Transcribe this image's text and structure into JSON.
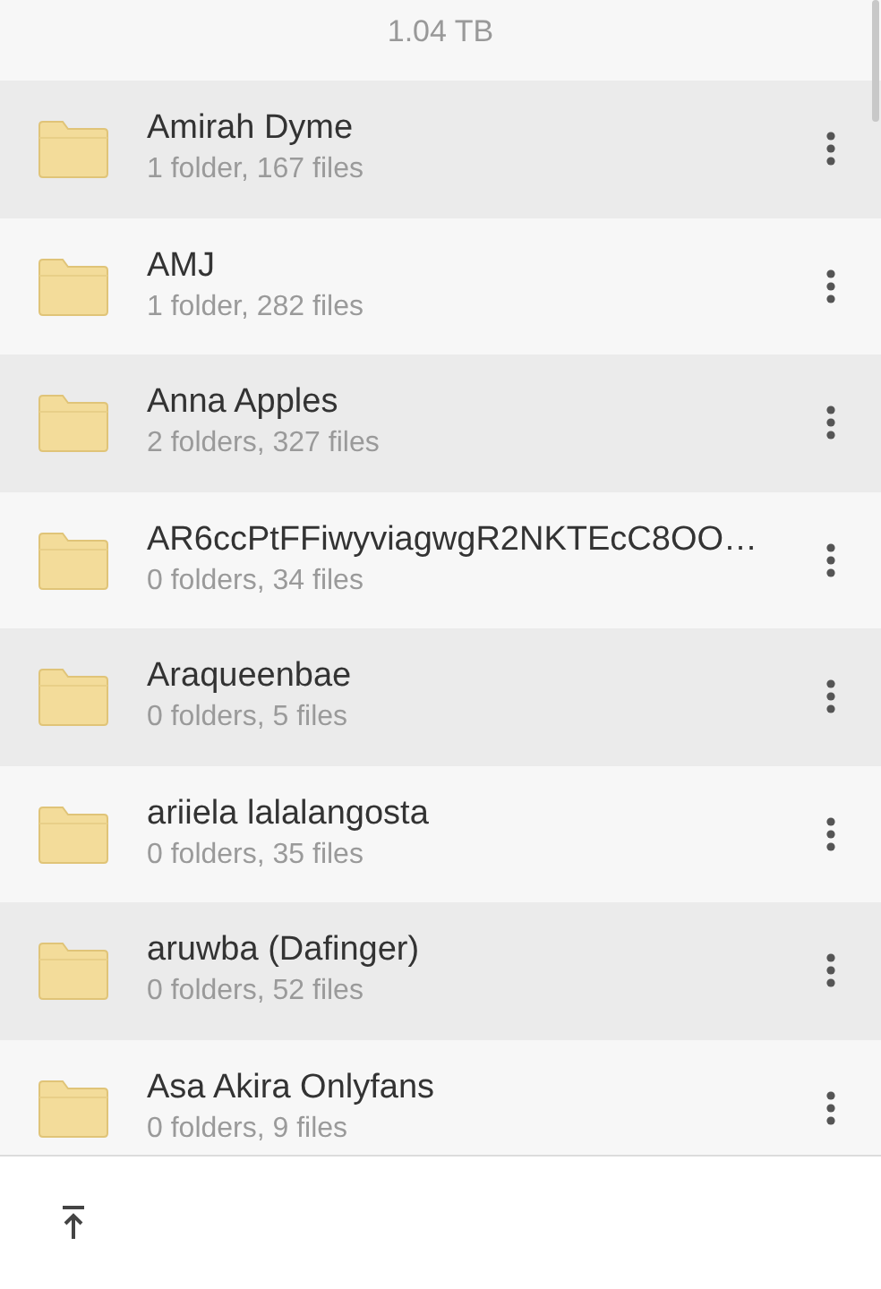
{
  "storage": {
    "total": "1.04 TB"
  },
  "folders": [
    {
      "name": "Amirah Dyme",
      "info": "1 folder, 167 files"
    },
    {
      "name": "AMJ",
      "info": "1 folder, 282 files"
    },
    {
      "name": "Anna Apples",
      "info": "2 folders, 327 files"
    },
    {
      "name": "AR6ccPtFFiwyviagwgR2NKTEcC8OO…",
      "info": "0 folders, 34 files"
    },
    {
      "name": "Araqueenbae",
      "info": "0 folders, 5 files"
    },
    {
      "name": "ariiela lalalangosta",
      "info": "0 folders, 35 files"
    },
    {
      "name": "aruwba (Dafinger)",
      "info": "0 folders, 52 files"
    },
    {
      "name": "Asa Akira Onlyfans",
      "info": "0 folders, 9 files"
    }
  ]
}
